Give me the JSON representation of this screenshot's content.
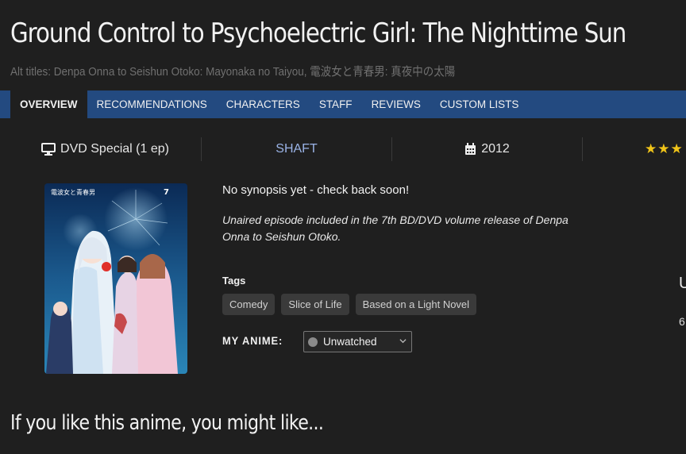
{
  "anime": {
    "title": "Ground Control to Psychoelectric Girl: The Nighttime Sun",
    "alt_titles": "Alt titles: Denpa Onna to Seishun Otoko: Mayonaka no Taiyou, 電波女と青春男: 真夜中の太陽"
  },
  "nav": {
    "tabs": [
      "OVERVIEW",
      "RECOMMENDATIONS",
      "CHARACTERS",
      "STAFF",
      "REVIEWS",
      "CUSTOM LISTS"
    ],
    "active": "OVERVIEW"
  },
  "stats": {
    "type": "DVD Special (1 ep)",
    "type_icon": "monitor-icon",
    "studio": "SHAFT",
    "year": "2012",
    "year_icon": "calendar-icon",
    "rating_stars": "★★★"
  },
  "cover": {
    "series_logo": "電波女と青春男",
    "volume_number": "7"
  },
  "synopsis": "No synopsis yet - check back soon!",
  "note": "Unaired episode included in the 7th BD/DVD volume release of Denpa Onna to Seishun Otoko.",
  "tags": {
    "label": "Tags",
    "items": [
      "Comedy",
      "Slice of Life",
      "Based on a Light Novel"
    ]
  },
  "my_anime": {
    "label": "MY ANIME:",
    "status": "Unwatched",
    "status_color": "#8a8a8a"
  },
  "side": {
    "partial_letter": "U",
    "partial_number": "6"
  },
  "section_heading": "If you like this anime, you might like...",
  "colors": {
    "background": "#1f1f1f",
    "nav_bar": "#234a80",
    "studio_link": "#9ab3e6",
    "star": "#f0c419"
  }
}
